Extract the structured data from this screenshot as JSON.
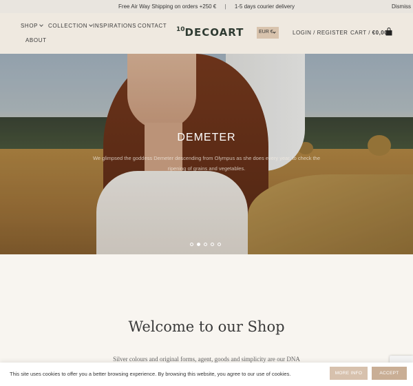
{
  "topbar": {
    "shipping": "Free Air Way Shipping on orders +250 €",
    "separator": "|",
    "delivery": "1-5 days courier delivery",
    "dismiss": "Dismiss"
  },
  "header": {
    "nav": {
      "shop": "SHOP",
      "collection": "COLLECTION",
      "inspirations": "INSPIRATIONS",
      "contact": "CONTACT",
      "about": "ABOUT"
    },
    "logo_prefix": "10",
    "logo_text": "DECOART",
    "currency": "EUR €",
    "login": "LOGIN / REGISTER",
    "cart_label": "CART /",
    "cart_total": "€0,00"
  },
  "hero": {
    "title": "DEMETER",
    "description": "We glimpsed the goddess Demeter descending from Olympus as she does every year, to check the ripening of grains and vegetables.",
    "slide_count": 5,
    "active_slide": 2
  },
  "main": {
    "welcome": "Welcome to our Shop",
    "tagline": "Silver colours and original forms, agent, goods and simplicity are our DNA"
  },
  "cookie": {
    "text": "This site uses cookies to offer you a better browsing experience. By browsing this website, you agree to our use of cookies.",
    "more_info": "MORE INFO",
    "accept": "ACCEPT"
  },
  "colors": {
    "header_bg": "#efe9e0",
    "accent": "#d8c3ad",
    "logo": "#2f3b32"
  }
}
